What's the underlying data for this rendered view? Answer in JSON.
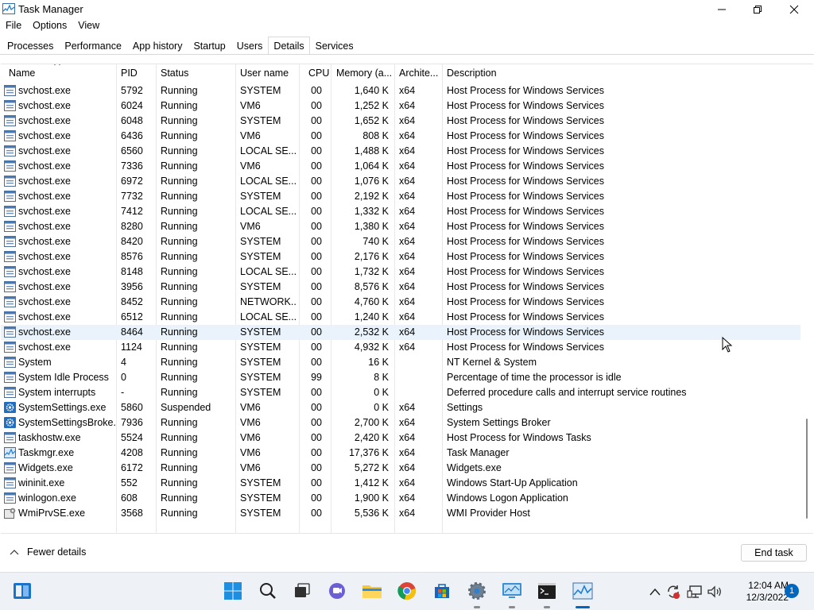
{
  "window": {
    "title": "Task Manager",
    "menu": [
      "File",
      "Options",
      "View"
    ],
    "tabs": [
      "Processes",
      "Performance",
      "App history",
      "Startup",
      "Users",
      "Details",
      "Services"
    ],
    "active_tab": "Details"
  },
  "table": {
    "columns": [
      "Name",
      "PID",
      "Status",
      "User name",
      "CPU",
      "Memory (a...",
      "Archite...",
      "Description"
    ],
    "rows": [
      {
        "icon": "service-icon",
        "name": "svchost.exe",
        "pid": "5792",
        "status": "Running",
        "user": "SYSTEM",
        "cpu": "00",
        "mem": "1,640 K",
        "arch": "x64",
        "desc": "Host Process for Windows Services"
      },
      {
        "icon": "service-icon",
        "name": "svchost.exe",
        "pid": "6024",
        "status": "Running",
        "user": "VM6",
        "cpu": "00",
        "mem": "1,252 K",
        "arch": "x64",
        "desc": "Host Process for Windows Services"
      },
      {
        "icon": "service-icon",
        "name": "svchost.exe",
        "pid": "6048",
        "status": "Running",
        "user": "SYSTEM",
        "cpu": "00",
        "mem": "1,652 K",
        "arch": "x64",
        "desc": "Host Process for Windows Services"
      },
      {
        "icon": "service-icon",
        "name": "svchost.exe",
        "pid": "6436",
        "status": "Running",
        "user": "VM6",
        "cpu": "00",
        "mem": "808 K",
        "arch": "x64",
        "desc": "Host Process for Windows Services"
      },
      {
        "icon": "service-icon",
        "name": "svchost.exe",
        "pid": "6560",
        "status": "Running",
        "user": "LOCAL SE...",
        "cpu": "00",
        "mem": "1,488 K",
        "arch": "x64",
        "desc": "Host Process for Windows Services"
      },
      {
        "icon": "service-icon",
        "name": "svchost.exe",
        "pid": "7336",
        "status": "Running",
        "user": "VM6",
        "cpu": "00",
        "mem": "1,064 K",
        "arch": "x64",
        "desc": "Host Process for Windows Services"
      },
      {
        "icon": "service-icon",
        "name": "svchost.exe",
        "pid": "6972",
        "status": "Running",
        "user": "LOCAL SE...",
        "cpu": "00",
        "mem": "1,076 K",
        "arch": "x64",
        "desc": "Host Process for Windows Services"
      },
      {
        "icon": "service-icon",
        "name": "svchost.exe",
        "pid": "7732",
        "status": "Running",
        "user": "SYSTEM",
        "cpu": "00",
        "mem": "2,192 K",
        "arch": "x64",
        "desc": "Host Process for Windows Services"
      },
      {
        "icon": "service-icon",
        "name": "svchost.exe",
        "pid": "7412",
        "status": "Running",
        "user": "LOCAL SE...",
        "cpu": "00",
        "mem": "1,332 K",
        "arch": "x64",
        "desc": "Host Process for Windows Services"
      },
      {
        "icon": "service-icon",
        "name": "svchost.exe",
        "pid": "8280",
        "status": "Running",
        "user": "VM6",
        "cpu": "00",
        "mem": "1,380 K",
        "arch": "x64",
        "desc": "Host Process for Windows Services"
      },
      {
        "icon": "service-icon",
        "name": "svchost.exe",
        "pid": "8420",
        "status": "Running",
        "user": "SYSTEM",
        "cpu": "00",
        "mem": "740 K",
        "arch": "x64",
        "desc": "Host Process for Windows Services"
      },
      {
        "icon": "service-icon",
        "name": "svchost.exe",
        "pid": "8576",
        "status": "Running",
        "user": "SYSTEM",
        "cpu": "00",
        "mem": "2,176 K",
        "arch": "x64",
        "desc": "Host Process for Windows Services"
      },
      {
        "icon": "service-icon",
        "name": "svchost.exe",
        "pid": "8148",
        "status": "Running",
        "user": "LOCAL SE...",
        "cpu": "00",
        "mem": "1,732 K",
        "arch": "x64",
        "desc": "Host Process for Windows Services"
      },
      {
        "icon": "service-icon",
        "name": "svchost.exe",
        "pid": "3956",
        "status": "Running",
        "user": "SYSTEM",
        "cpu": "00",
        "mem": "8,576 K",
        "arch": "x64",
        "desc": "Host Process for Windows Services"
      },
      {
        "icon": "service-icon",
        "name": "svchost.exe",
        "pid": "8452",
        "status": "Running",
        "user": "NETWORK...",
        "cpu": "00",
        "mem": "4,760 K",
        "arch": "x64",
        "desc": "Host Process for Windows Services"
      },
      {
        "icon": "service-icon",
        "name": "svchost.exe",
        "pid": "6512",
        "status": "Running",
        "user": "LOCAL SE...",
        "cpu": "00",
        "mem": "1,240 K",
        "arch": "x64",
        "desc": "Host Process for Windows Services"
      },
      {
        "icon": "service-icon",
        "name": "svchost.exe",
        "pid": "8464",
        "status": "Running",
        "user": "SYSTEM",
        "cpu": "00",
        "mem": "2,532 K",
        "arch": "x64",
        "desc": "Host Process for Windows Services",
        "selected": true
      },
      {
        "icon": "service-icon",
        "name": "svchost.exe",
        "pid": "1124",
        "status": "Running",
        "user": "SYSTEM",
        "cpu": "00",
        "mem": "4,932 K",
        "arch": "x64",
        "desc": "Host Process for Windows Services"
      },
      {
        "icon": "service-icon",
        "name": "System",
        "pid": "4",
        "status": "Running",
        "user": "SYSTEM",
        "cpu": "00",
        "mem": "16 K",
        "arch": "",
        "desc": "NT Kernel & System"
      },
      {
        "icon": "service-icon",
        "name": "System Idle Process",
        "pid": "0",
        "status": "Running",
        "user": "SYSTEM",
        "cpu": "99",
        "mem": "8 K",
        "arch": "",
        "desc": "Percentage of time the processor is idle"
      },
      {
        "icon": "service-icon",
        "name": "System interrupts",
        "pid": "-",
        "status": "Running",
        "user": "SYSTEM",
        "cpu": "00",
        "mem": "0 K",
        "arch": "",
        "desc": "Deferred procedure calls and interrupt service routines"
      },
      {
        "icon": "settings-gear-icon",
        "name": "SystemSettings.exe",
        "pid": "5860",
        "status": "Suspended",
        "user": "VM6",
        "cpu": "00",
        "mem": "0 K",
        "arch": "x64",
        "desc": "Settings"
      },
      {
        "icon": "settings-gear-icon",
        "name": "SystemSettingsBroke...",
        "pid": "7936",
        "status": "Running",
        "user": "VM6",
        "cpu": "00",
        "mem": "2,700 K",
        "arch": "x64",
        "desc": "System Settings Broker"
      },
      {
        "icon": "service-icon",
        "name": "taskhostw.exe",
        "pid": "5524",
        "status": "Running",
        "user": "VM6",
        "cpu": "00",
        "mem": "2,420 K",
        "arch": "x64",
        "desc": "Host Process for Windows Tasks"
      },
      {
        "icon": "task-manager-icon",
        "name": "Taskmgr.exe",
        "pid": "4208",
        "status": "Running",
        "user": "VM6",
        "cpu": "00",
        "mem": "17,376 K",
        "arch": "x64",
        "desc": "Task Manager"
      },
      {
        "icon": "service-icon",
        "name": "Widgets.exe",
        "pid": "6172",
        "status": "Running",
        "user": "VM6",
        "cpu": "00",
        "mem": "5,272 K",
        "arch": "x64",
        "desc": "Widgets.exe"
      },
      {
        "icon": "service-icon",
        "name": "wininit.exe",
        "pid": "552",
        "status": "Running",
        "user": "SYSTEM",
        "cpu": "00",
        "mem": "1,412 K",
        "arch": "x64",
        "desc": "Windows Start-Up Application"
      },
      {
        "icon": "service-icon",
        "name": "winlogon.exe",
        "pid": "608",
        "status": "Running",
        "user": "SYSTEM",
        "cpu": "00",
        "mem": "1,900 K",
        "arch": "x64",
        "desc": "Windows Logon Application"
      },
      {
        "icon": "wmi-icon",
        "name": "WmiPrvSE.exe",
        "pid": "3568",
        "status": "Running",
        "user": "SYSTEM",
        "cpu": "00",
        "mem": "5,536 K",
        "arch": "x64",
        "desc": "WMI Provider Host"
      }
    ]
  },
  "footer": {
    "fewer_details": "Fewer details",
    "end_task": "End task"
  },
  "taskbar": {
    "time": "12:04 AM",
    "date": "12/3/2022",
    "notification_count": "1"
  },
  "colors": {
    "accent": "#0067c0",
    "selected_row": "#eaf3fb",
    "taskbar_bg": "#eef1f5"
  }
}
